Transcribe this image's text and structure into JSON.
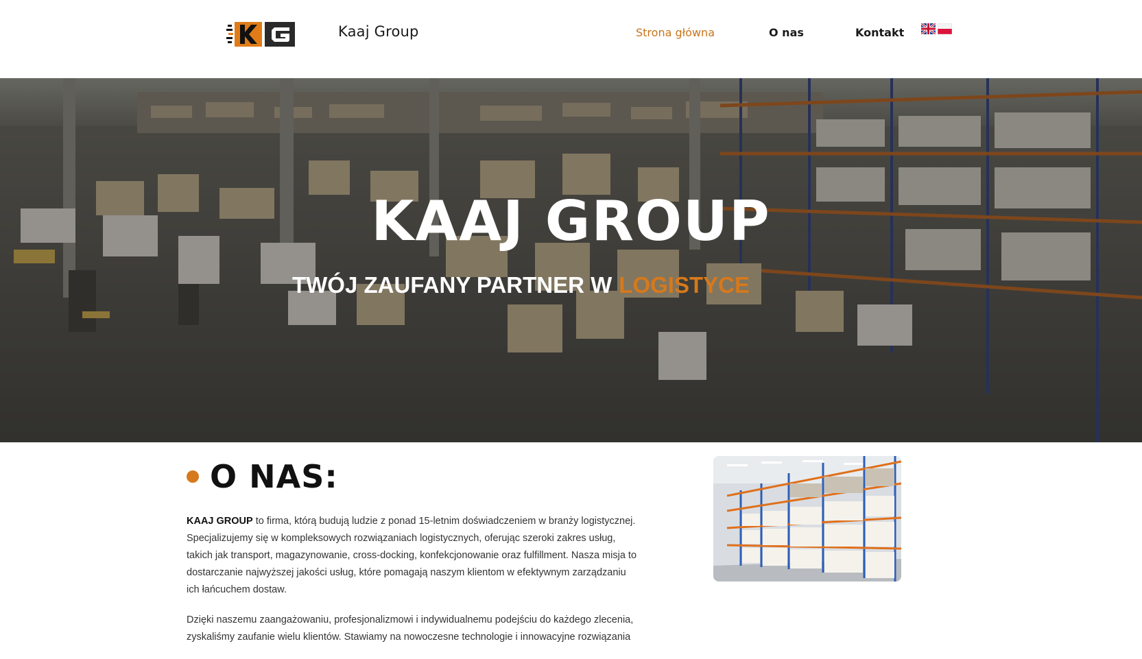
{
  "header": {
    "brand": "Kaaj Group",
    "logo_text": "KG",
    "nav": {
      "home": "Strona główna",
      "about": "O nas",
      "contact": "Kontakt"
    },
    "flags": [
      "english-flag",
      "polish-flag"
    ]
  },
  "hero": {
    "title": "KAAJ GROUP",
    "subtitle_prefix": "TWÓJ ZAUFANY PARTNER W",
    "subtitle_accent": "LOGISTYCE"
  },
  "about": {
    "title": "O NAS:",
    "paragraph1_bold": "KAAJ GROUP",
    "paragraph1_rest": " to firma, którą budują ludzie z ponad 15-letnim doświadczeniem w branży logistycznej. Specjalizujemy się w kompleksowych rozwiązaniach logistycznych, oferując szeroki zakres usług, takich jak transport, magazynowanie, cross-docking, konfekcjonowanie oraz fulfillment. Nasza misja to dostarczanie najwyższej jakości usług, które pomagają naszym klientom w efektywnym zarządzaniu ich łańcuchem dostaw.",
    "paragraph2": "Dzięki naszemu zaangażowaniu, profesjonalizmowi i indywidualnemu podejściu do każdego zlecenia, zyskaliśmy zaufanie wielu klientów. Stawiamy na nowoczesne technologie i innowacyjne rozwiązania"
  },
  "colors": {
    "accent": "#d6791c",
    "text": "#1a1a1a"
  }
}
